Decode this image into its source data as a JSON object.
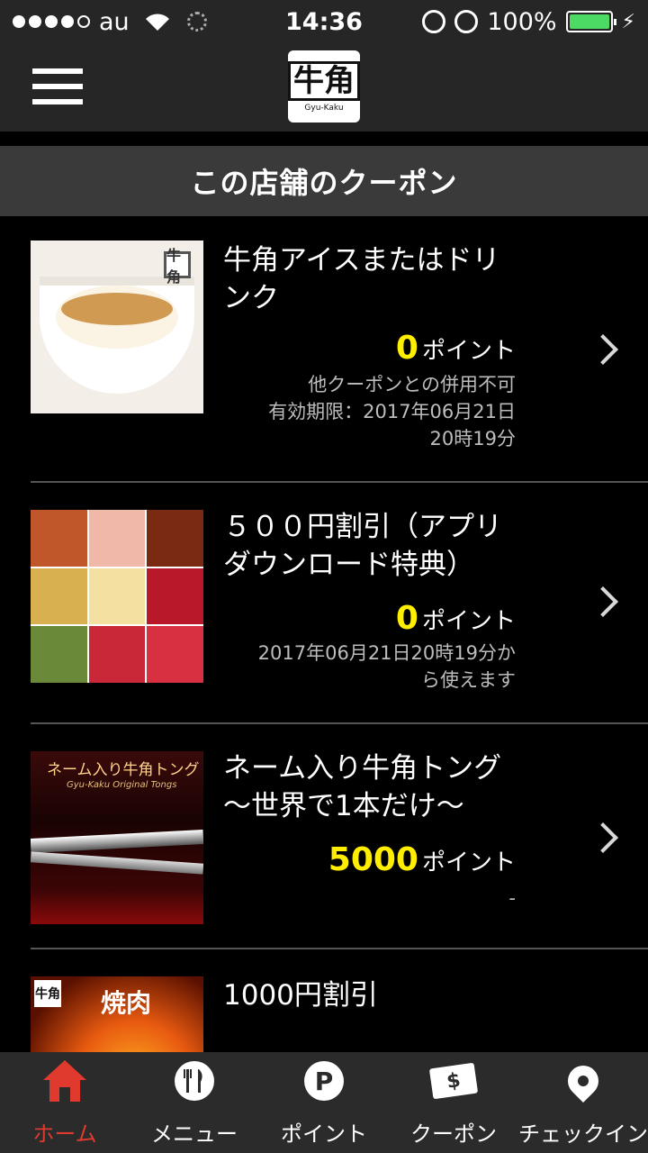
{
  "status_bar": {
    "carrier": "au",
    "time": "14:36",
    "battery": "100%",
    "battery_level": 1.0
  },
  "nav": {
    "logo_text": "牛角",
    "logo_sub": "Gyu-Kaku"
  },
  "section_title": "この店舗のクーポン",
  "coupons": [
    {
      "title": "牛角アイスまたはドリンク",
      "points": "0",
      "points_unit": "ポイント",
      "notes": [
        "他クーポンとの併用不可",
        "有効期限：2017年06月21日",
        "20時19分"
      ]
    },
    {
      "title": "５００円割引（アプリダウンロード特典）",
      "points": "0",
      "points_unit": "ポイント",
      "notes": [
        "2017年06月21日20時19分か",
        "ら使えます"
      ]
    },
    {
      "title": "ネーム入り牛角トング～世界で1本だけ～",
      "points": "5000",
      "points_unit": "ポイント",
      "notes": [
        "-"
      ],
      "thumb_text": "ネーム入り牛角トング",
      "thumb_sub": "Gyu-Kaku Original Tongs"
    },
    {
      "title": "1000円割引",
      "thumb_text": "焼肉"
    }
  ],
  "thumb_mark": "牛角",
  "tabs": [
    {
      "label": "ホーム",
      "icon": "home-icon",
      "active": true
    },
    {
      "label": "メニュー",
      "icon": "fork-knife-icon",
      "active": false
    },
    {
      "label": "ポイント",
      "icon": "point-icon",
      "icon_text": "P",
      "active": false
    },
    {
      "label": "クーポン",
      "icon": "coupon-ticket-icon",
      "icon_text": "$",
      "active": false
    },
    {
      "label": "チェックイン",
      "icon": "location-pin-icon",
      "active": false
    }
  ],
  "colors": {
    "accent_red": "#e03a2e",
    "points_yellow": "#ffee00",
    "bar_gray": "#262626"
  }
}
